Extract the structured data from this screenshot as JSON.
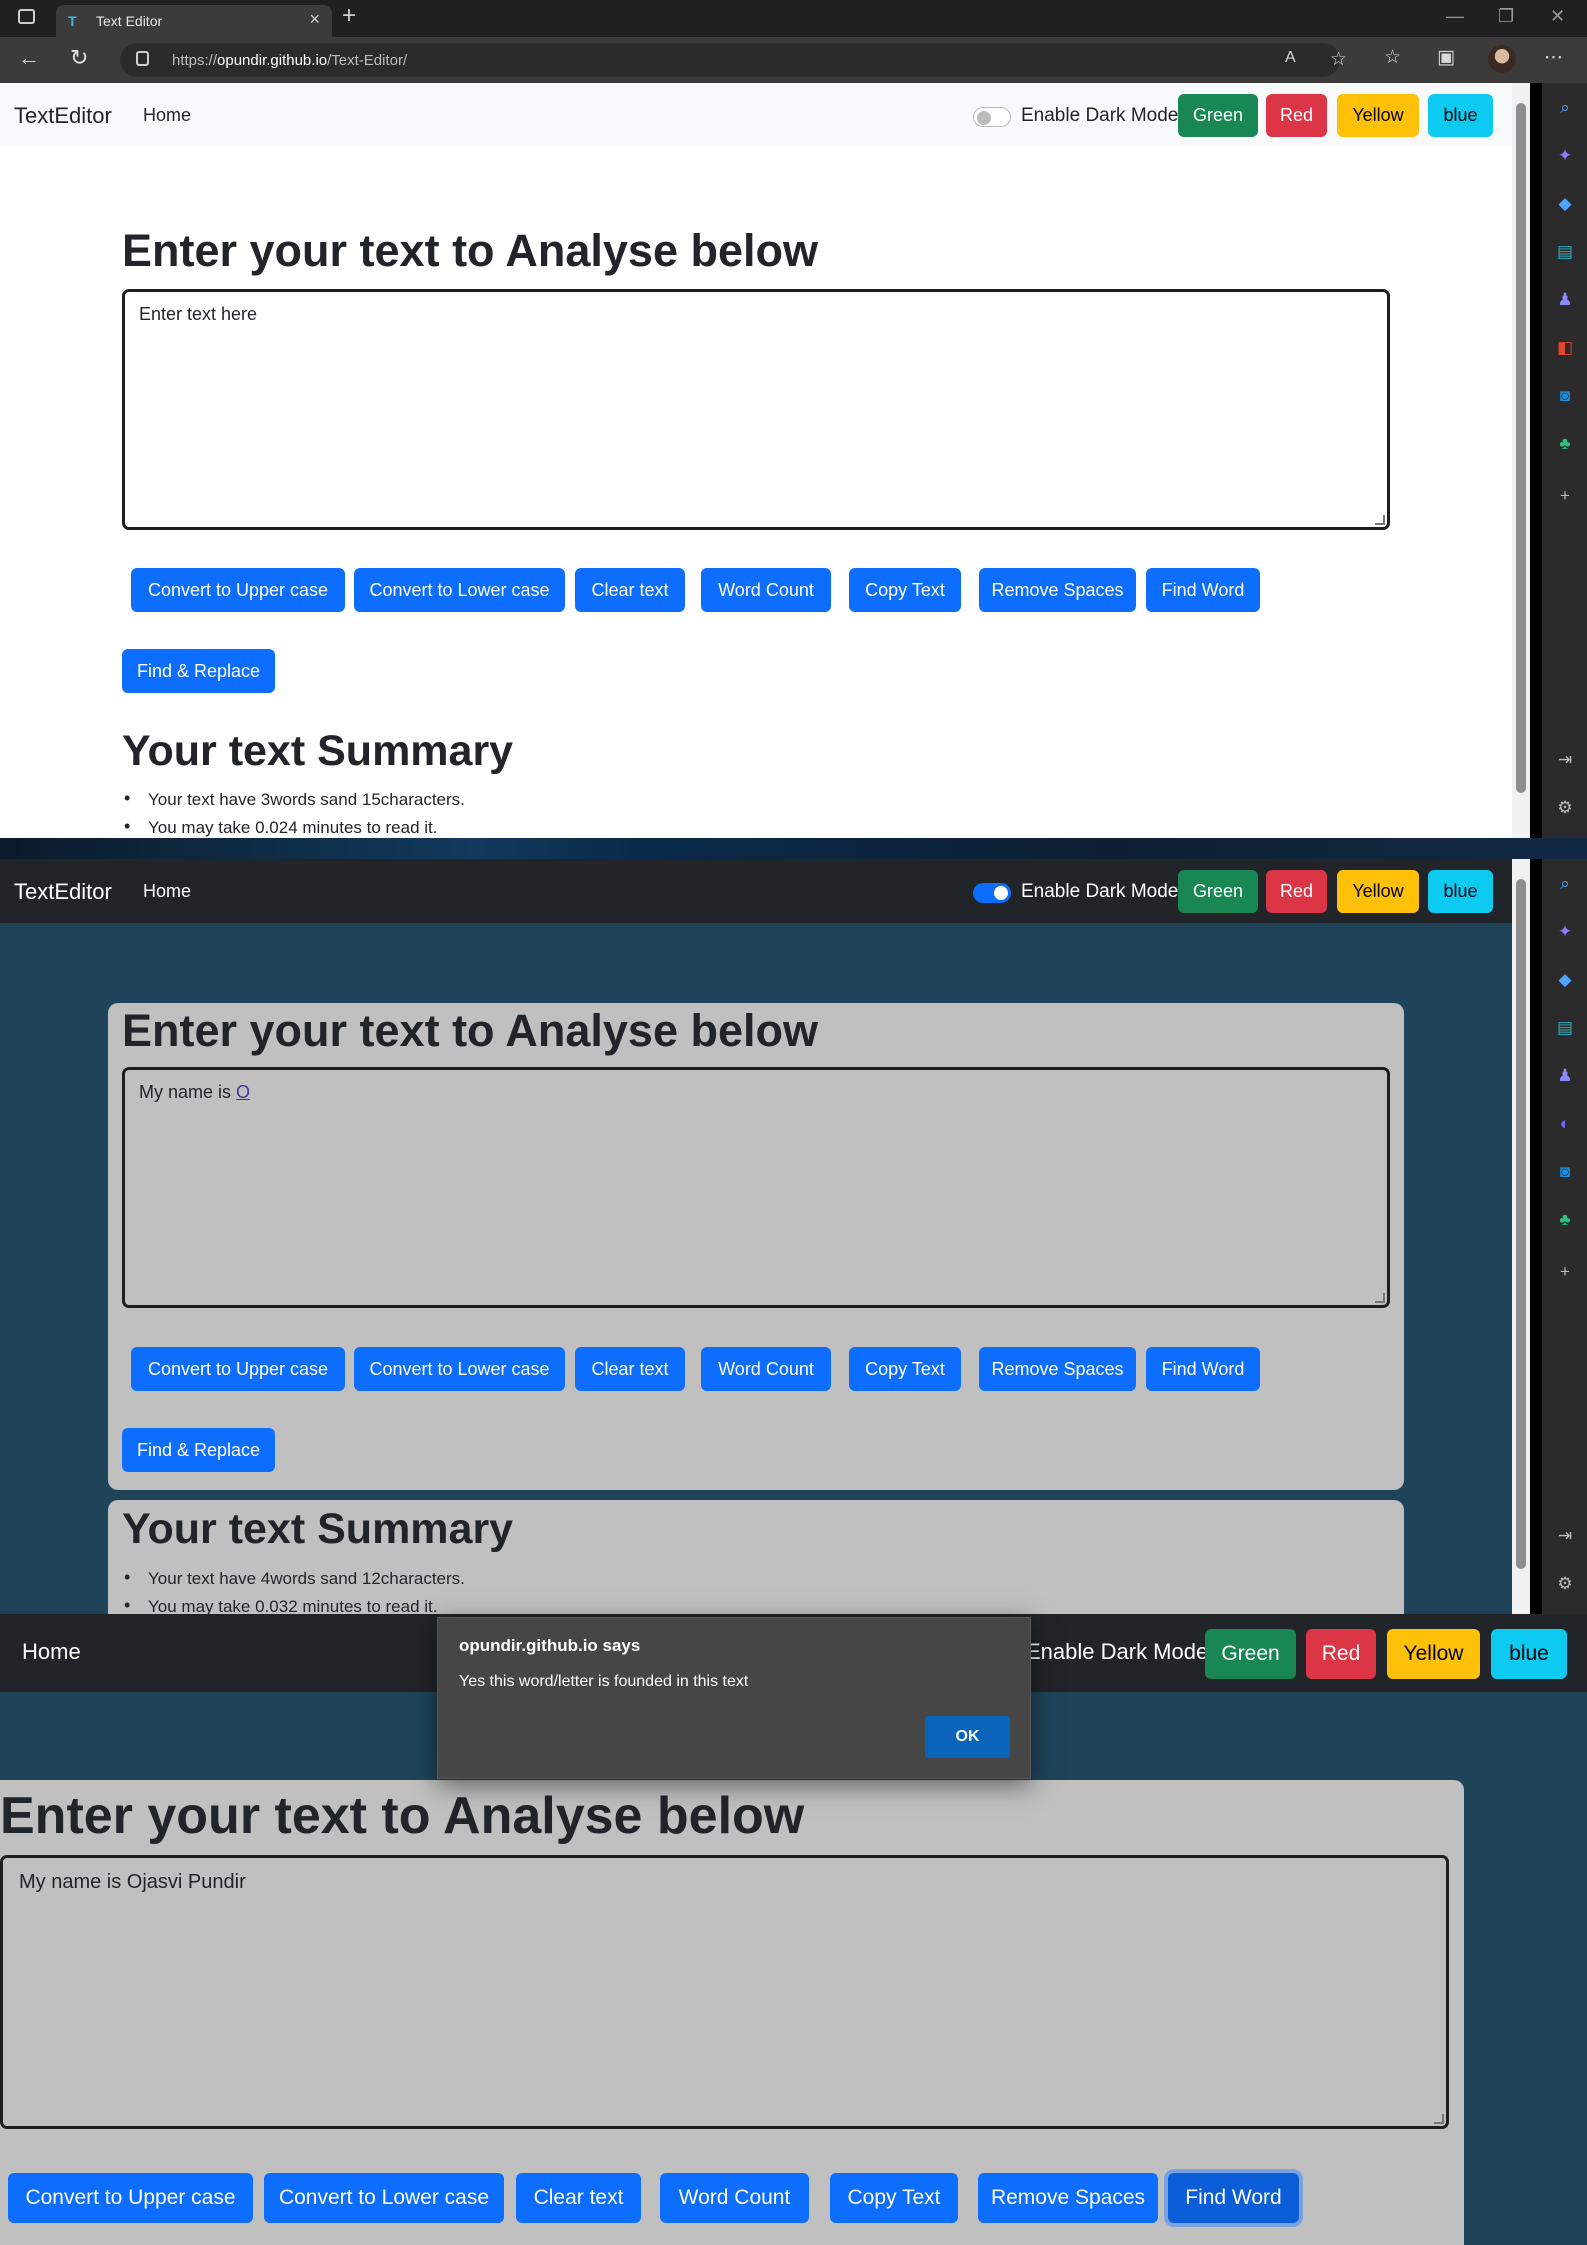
{
  "browser": {
    "tab_title": "Text Editor",
    "tab_favicon": "T",
    "url_prefix": "https://",
    "url_host": "opundir.github.io",
    "url_path": "/Text-Editor/"
  },
  "navbar": {
    "brand": "TextEditor",
    "home": "Home",
    "dark_mode_label": "Enable Dark Mode",
    "color_buttons": [
      {
        "label": "Green",
        "bg": "#198754",
        "fg": "#ffffff"
      },
      {
        "label": "Red",
        "bg": "#dc3545",
        "fg": "#ffffff"
      },
      {
        "label": "Yellow",
        "bg": "#ffc107",
        "fg": "#000000"
      },
      {
        "label": "blue",
        "bg": "#0dcaf0",
        "fg": "#000000"
      }
    ]
  },
  "main": {
    "heading": "Enter your text to Analyse below",
    "buttons": [
      "Convert to Upper case",
      "Convert to Lower case",
      "Clear text",
      "Word Count",
      "Copy Text",
      "Remove Spaces",
      "Find Word",
      "Find & Replace"
    ],
    "summary_heading": "Your text Summary"
  },
  "screens": [
    {
      "mode": "light",
      "textarea_placeholder": "Enter text here",
      "textarea_value": "",
      "summary_words": "Your text have 3words sand 15characters.",
      "summary_time": "You may take 0.024 minutes to read it."
    },
    {
      "mode": "dark",
      "textarea_value_plain": "My name is ",
      "textarea_value_underlined": "O",
      "summary_words": "Your text have 4words sand 12characters.",
      "summary_time": "You may take 0.032 minutes to read it."
    },
    {
      "mode": "dark-zoomed",
      "textarea_value": "My name is Ojasvi Pundir"
    }
  ],
  "dialog": {
    "site": "opundir.github.io says",
    "message": "Yes this word/letter is founded in this text",
    "ok": "OK"
  },
  "colors": {
    "primary": "#0d6efd",
    "dark_bg": "#1f4459",
    "navbar_dark": "#212529",
    "card_bg": "#c0c0c0"
  },
  "sidebar_icons": [
    "search-icon",
    "copilot-icon",
    "tag-icon",
    "toolbox-icon",
    "people-icon",
    "office-icon",
    "outlook-icon",
    "tree-icon",
    "plus-icon"
  ]
}
